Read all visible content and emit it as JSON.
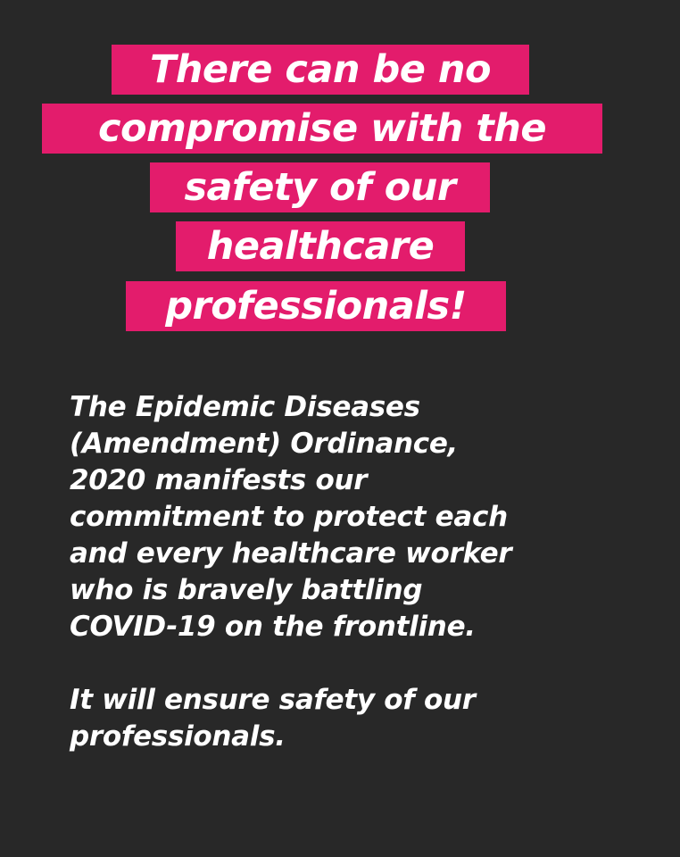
{
  "headline": {
    "lines": [
      "There can be no",
      "compromise with the",
      "safety of our",
      "healthcare",
      "professionals!"
    ]
  },
  "body": {
    "paragraph1": [
      "The Epidemic Diseases",
      "(Amendment) Ordinance,",
      "2020 manifests our",
      "commitment to protect each",
      "and every healthcare worker",
      "who is bravely battling",
      "COVID-19 on the frontline."
    ],
    "paragraph2": [
      "It will ensure safety of our",
      "professionals."
    ]
  },
  "colors": {
    "background": "#282828",
    "highlight": "#e31c6c",
    "text": "#ffffff"
  }
}
